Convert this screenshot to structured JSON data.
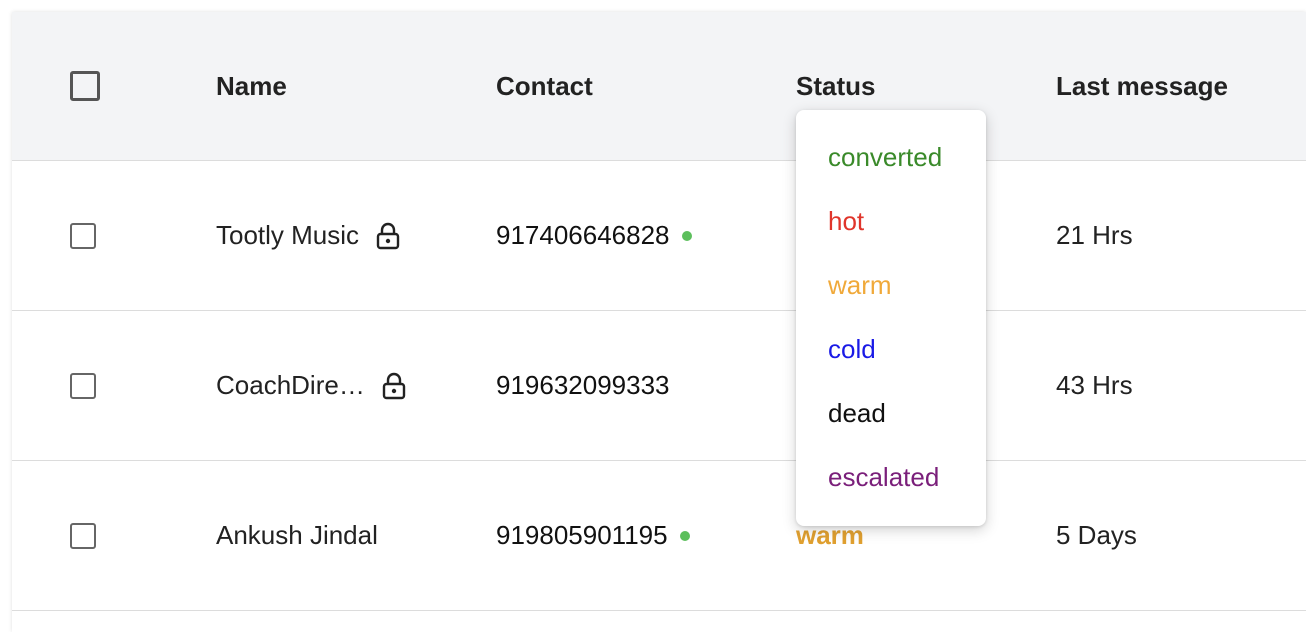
{
  "table": {
    "columns": {
      "name": "Name",
      "contact": "Contact",
      "status": "Status",
      "last_message": "Last message"
    },
    "rows": [
      {
        "name": "Tootly Music",
        "locked": true,
        "contact": "917406646828",
        "online": true,
        "status": "",
        "last_message": "21 Hrs"
      },
      {
        "name": "CoachDire…",
        "locked": true,
        "contact": "919632099333",
        "online": false,
        "status": "",
        "last_message": "43 Hrs"
      },
      {
        "name": "Ankush Jindal",
        "locked": false,
        "contact": "919805901195",
        "online": true,
        "status": "warm",
        "last_message": "5 Days"
      }
    ]
  },
  "status_dropdown": {
    "options": [
      {
        "label": "converted",
        "color": "#3a8a2a"
      },
      {
        "label": "hot",
        "color": "#e0352b"
      },
      {
        "label": "warm",
        "color": "#f0a93a"
      },
      {
        "label": "cold",
        "color": "#1a1ae6"
      },
      {
        "label": "dead",
        "color": "#111111"
      },
      {
        "label": "escalated",
        "color": "#7a1f7a"
      }
    ]
  },
  "colors": {
    "header_bg": "#f3f4f6",
    "online": "#5cbf5c",
    "warm_status": "#e0a030"
  },
  "icons": {
    "lock": "lock-icon",
    "online": "online-dot"
  }
}
